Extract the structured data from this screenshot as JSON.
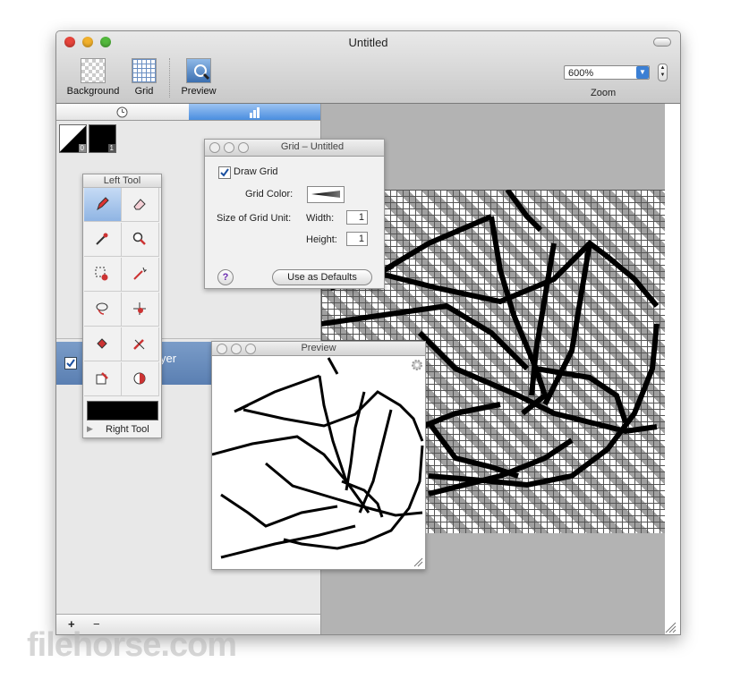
{
  "window": {
    "title": "Untitled"
  },
  "toolbar": {
    "background_label": "Background",
    "grid_label": "Grid",
    "preview_label": "Preview",
    "zoom_value": "600%",
    "zoom_label": "Zoom"
  },
  "left_tool_palette": {
    "title": "Left Tool",
    "tools": [
      "pencil-icon",
      "eraser-icon",
      "eyedropper-icon",
      "zoom-icon",
      "marquee-icon",
      "magic-wand-icon",
      "lasso-icon",
      "move-icon",
      "paint-bucket-icon",
      "pen-icon",
      "fill-icon",
      "gradient-icon"
    ],
    "right_tool_label": "Right Tool"
  },
  "layers": {
    "swatch_badges": [
      "0",
      "1"
    ],
    "layer_name_partial": "yer",
    "layer_visible": true,
    "add_label": "+",
    "remove_label": "−"
  },
  "grid_panel": {
    "title": "Grid – Untitled",
    "draw_grid_label": "Draw Grid",
    "draw_grid_checked": true,
    "grid_color_label": "Grid Color:",
    "size_label": "Size of Grid Unit:",
    "width_label": "Width:",
    "width_value": "1",
    "height_label": "Height:",
    "height_value": "1",
    "help_label": "?",
    "defaults_button": "Use as Defaults"
  },
  "preview_panel": {
    "title": "Preview"
  },
  "watermark": "filehorse.com",
  "colors": {
    "accent": "#3b7fd4",
    "canvas_bg": "#b3b3b3",
    "grid_stripe": "#a0a0a0",
    "selection": "#8fb4e3"
  }
}
